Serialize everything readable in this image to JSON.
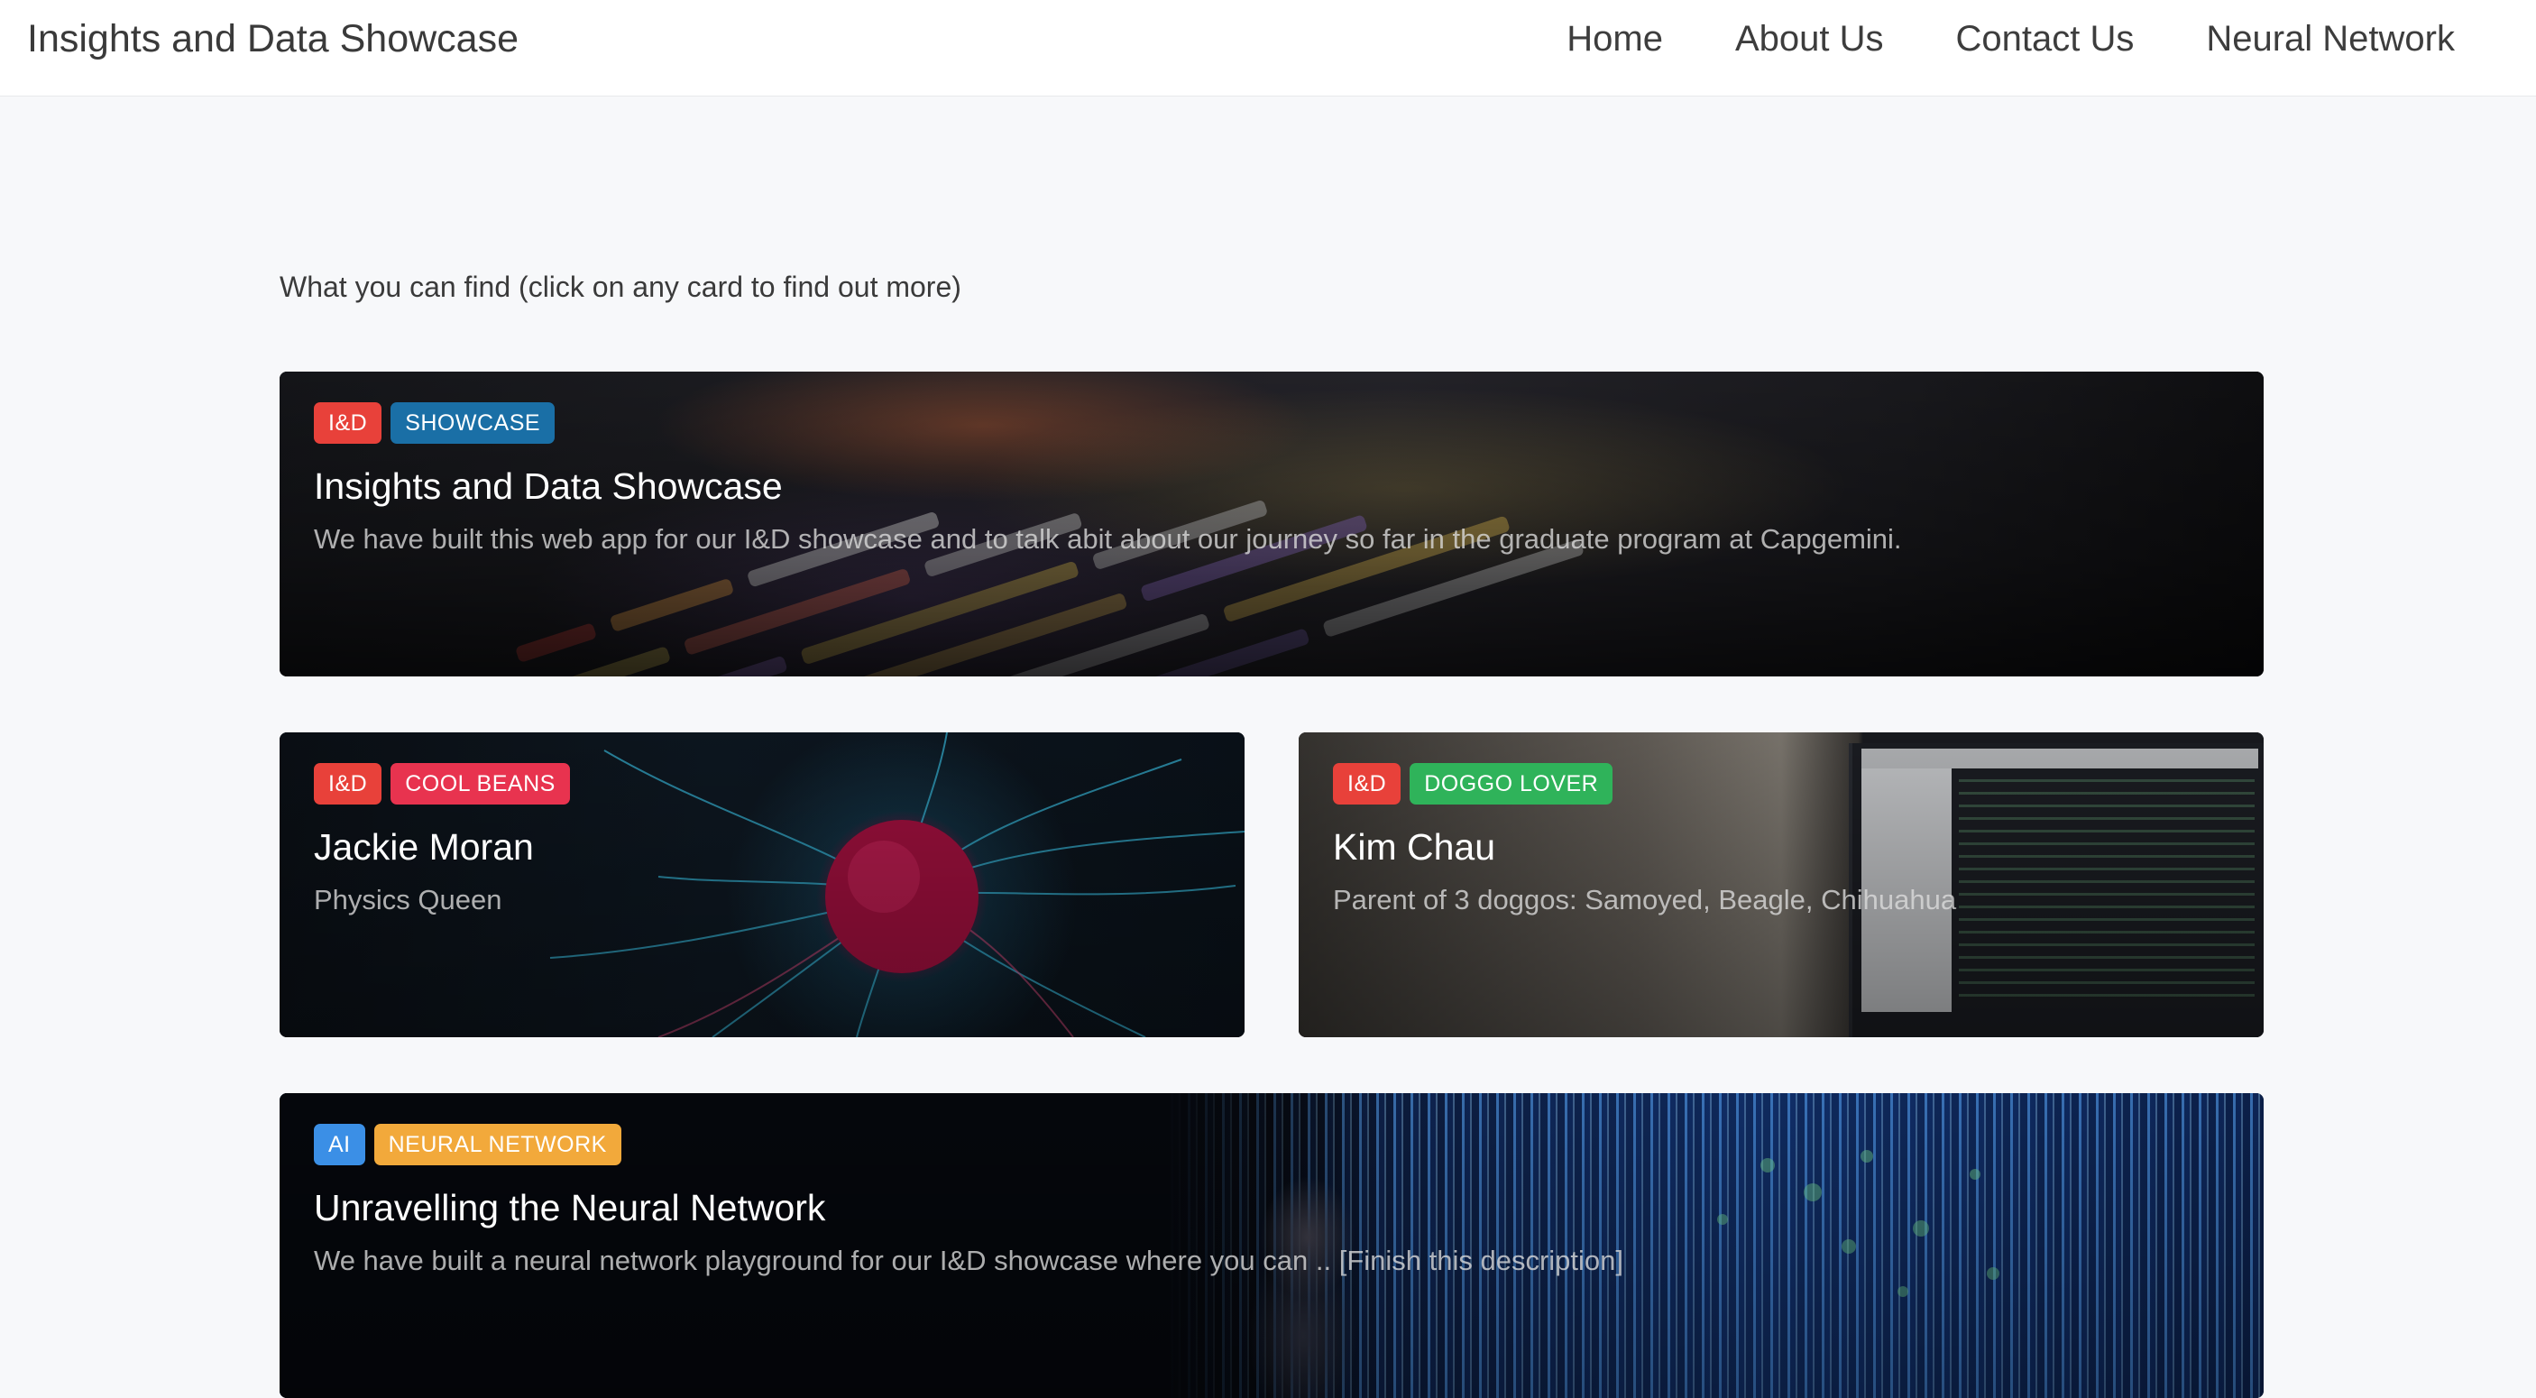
{
  "navbar": {
    "brand": "Insights and Data Showcase",
    "links": [
      {
        "label": "Home"
      },
      {
        "label": "About Us"
      },
      {
        "label": "Contact Us"
      },
      {
        "label": "Neural Network"
      }
    ]
  },
  "intro": "What you can find (click on any card to find out more)",
  "cards": [
    {
      "badges": [
        {
          "label": "I&D",
          "color": "#e8413a"
        },
        {
          "label": "SHOWCASE",
          "color": "#1a6fa6"
        }
      ],
      "title": "Insights and Data Showcase",
      "description": "We have built this web app for our I&D showcase and to talk abit about our journey so far in the graduate program at Capgemini."
    },
    {
      "badges": [
        {
          "label": "I&D",
          "color": "#e8413a"
        },
        {
          "label": "COOL BEANS",
          "color": "#e8334f"
        }
      ],
      "title": "Jackie Moran",
      "description": "Physics Queen"
    },
    {
      "badges": [
        {
          "label": "I&D",
          "color": "#e8413a"
        },
        {
          "label": "DOGGO LOVER",
          "color": "#2fb35a"
        }
      ],
      "title": "Kim Chau",
      "description": "Parent of 3 doggos: Samoyed, Beagle, Chihuahua"
    },
    {
      "badges": [
        {
          "label": "AI",
          "color": "#3b8fe6"
        },
        {
          "label": "NEURAL NETWORK",
          "color": "#f2a93b"
        }
      ],
      "title": "Unravelling the Neural Network",
      "description": "We have built a neural network playground for our I&D showcase where you can .. [Finish this description]"
    }
  ]
}
